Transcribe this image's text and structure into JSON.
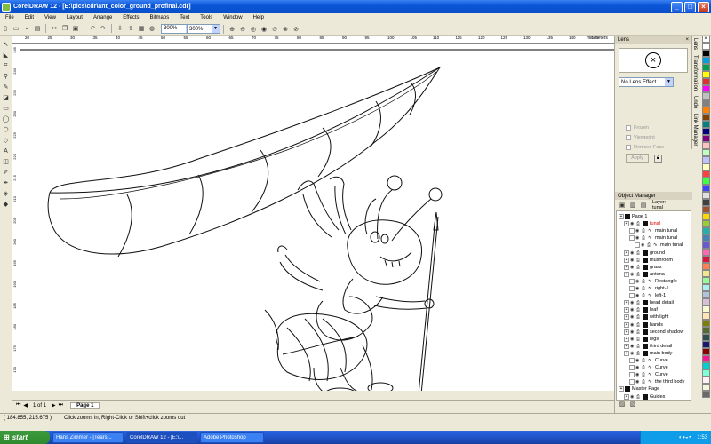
{
  "window": {
    "title": "CorelDRAW 12 - [E:\\pics\\cdr\\ant_color_ground_profinal.cdr]"
  },
  "menu": [
    "File",
    "Edit",
    "View",
    "Layout",
    "Arrange",
    "Effects",
    "Bitmaps",
    "Text",
    "Tools",
    "Window",
    "Help"
  ],
  "toolbar": {
    "zoom1": "300%",
    "zoom2": "300%"
  },
  "ruler": {
    "unit": "millimeters",
    "ticks": [
      "20",
      "25",
      "30",
      "35",
      "40",
      "45",
      "50",
      "55",
      "60",
      "65",
      "70",
      "75",
      "80",
      "85",
      "90",
      "95",
      "100",
      "105",
      "110",
      "115",
      "120",
      "125",
      "130",
      "135",
      "140",
      "145"
    ],
    "vticks": [
      "245",
      "240",
      "235",
      "230",
      "225",
      "220",
      "215",
      "210",
      "205",
      "200",
      "195",
      "190",
      "185",
      "180",
      "175",
      "170"
    ]
  },
  "pages": {
    "nav": "1 of 1",
    "tab": "Page 1"
  },
  "status": {
    "coords": "( 184.855, 215.675 )",
    "hint": "Click zooms in, Right-Click or Shift+click zooms out"
  },
  "lens": {
    "title": "Lens",
    "effect": "No Lens Effect",
    "options": [
      "Frozen",
      "Viewpoint",
      "Remove Face"
    ],
    "apply": "Apply"
  },
  "docker_tabs": [
    "Lens",
    "Transformation",
    "Undo",
    "Link Manager"
  ],
  "object_manager": {
    "title": "Object Manager",
    "layer_label": "Layer:",
    "layer_name": "tunal",
    "tree": [
      {
        "label": "Page 1",
        "level": 0
      },
      {
        "label": "tunal",
        "level": 1,
        "red": true
      },
      {
        "label": "main tunal",
        "level": 2
      },
      {
        "label": "main tunal",
        "level": 2
      },
      {
        "label": "main tunal",
        "level": 3
      },
      {
        "label": "ground",
        "level": 1
      },
      {
        "label": "mushroom",
        "level": 1
      },
      {
        "label": "grass",
        "level": 1
      },
      {
        "label": "antena",
        "level": 1
      },
      {
        "label": "Rectangle",
        "level": 2
      },
      {
        "label": "right-1",
        "level": 2
      },
      {
        "label": "left-1",
        "level": 2
      },
      {
        "label": "head detail",
        "level": 1
      },
      {
        "label": "leaf",
        "level": 1
      },
      {
        "label": "with light",
        "level": 1
      },
      {
        "label": "hands",
        "level": 1
      },
      {
        "label": "second shadow",
        "level": 1
      },
      {
        "label": "legs",
        "level": 1
      },
      {
        "label": "third detail",
        "level": 1
      },
      {
        "label": "main body",
        "level": 1
      },
      {
        "label": "Curve",
        "level": 2
      },
      {
        "label": "Curve",
        "level": 2
      },
      {
        "label": "Curve",
        "level": 2
      },
      {
        "label": "the third body",
        "level": 2
      },
      {
        "label": "Master Page",
        "level": 0
      },
      {
        "label": "Guides",
        "level": 1
      }
    ]
  },
  "palette": [
    "#ffffff",
    "#000000",
    "#00a0e0",
    "#00a050",
    "#ffff00",
    "#e03030",
    "#ff00ff",
    "#c0c0c0",
    "#808080",
    "#ff8000",
    "#804000",
    "#008080",
    "#000080",
    "#800080",
    "#ffc0c0",
    "#c0ffc0",
    "#c0c0ff",
    "#ffffc0",
    "#ff4040",
    "#40ff40",
    "#4040ff",
    "#e0e0e0",
    "#404040",
    "#a0522d",
    "#ffd700",
    "#9acd32",
    "#20b2aa",
    "#4682b4",
    "#6a5acd",
    "#ff69b4",
    "#dc143c",
    "#ff7f50",
    "#f0e68c",
    "#98fb98",
    "#afeeee",
    "#b0c4de",
    "#d8bfd8",
    "#fafad2",
    "#ffe4b5",
    "#808000",
    "#556b2f",
    "#2f4f4f",
    "#191970",
    "#8b0000",
    "#ff1493",
    "#00ced1",
    "#7fffd4",
    "#fff0f5",
    "#f5f5dc",
    "#696969"
  ],
  "taskbar": {
    "start": "start",
    "tasks": [
      "Hans Zimmer - [Tears...",
      "CorelDRAW 12 - [E:\\...",
      "Adobe Photoshop"
    ],
    "time": "1:53"
  }
}
